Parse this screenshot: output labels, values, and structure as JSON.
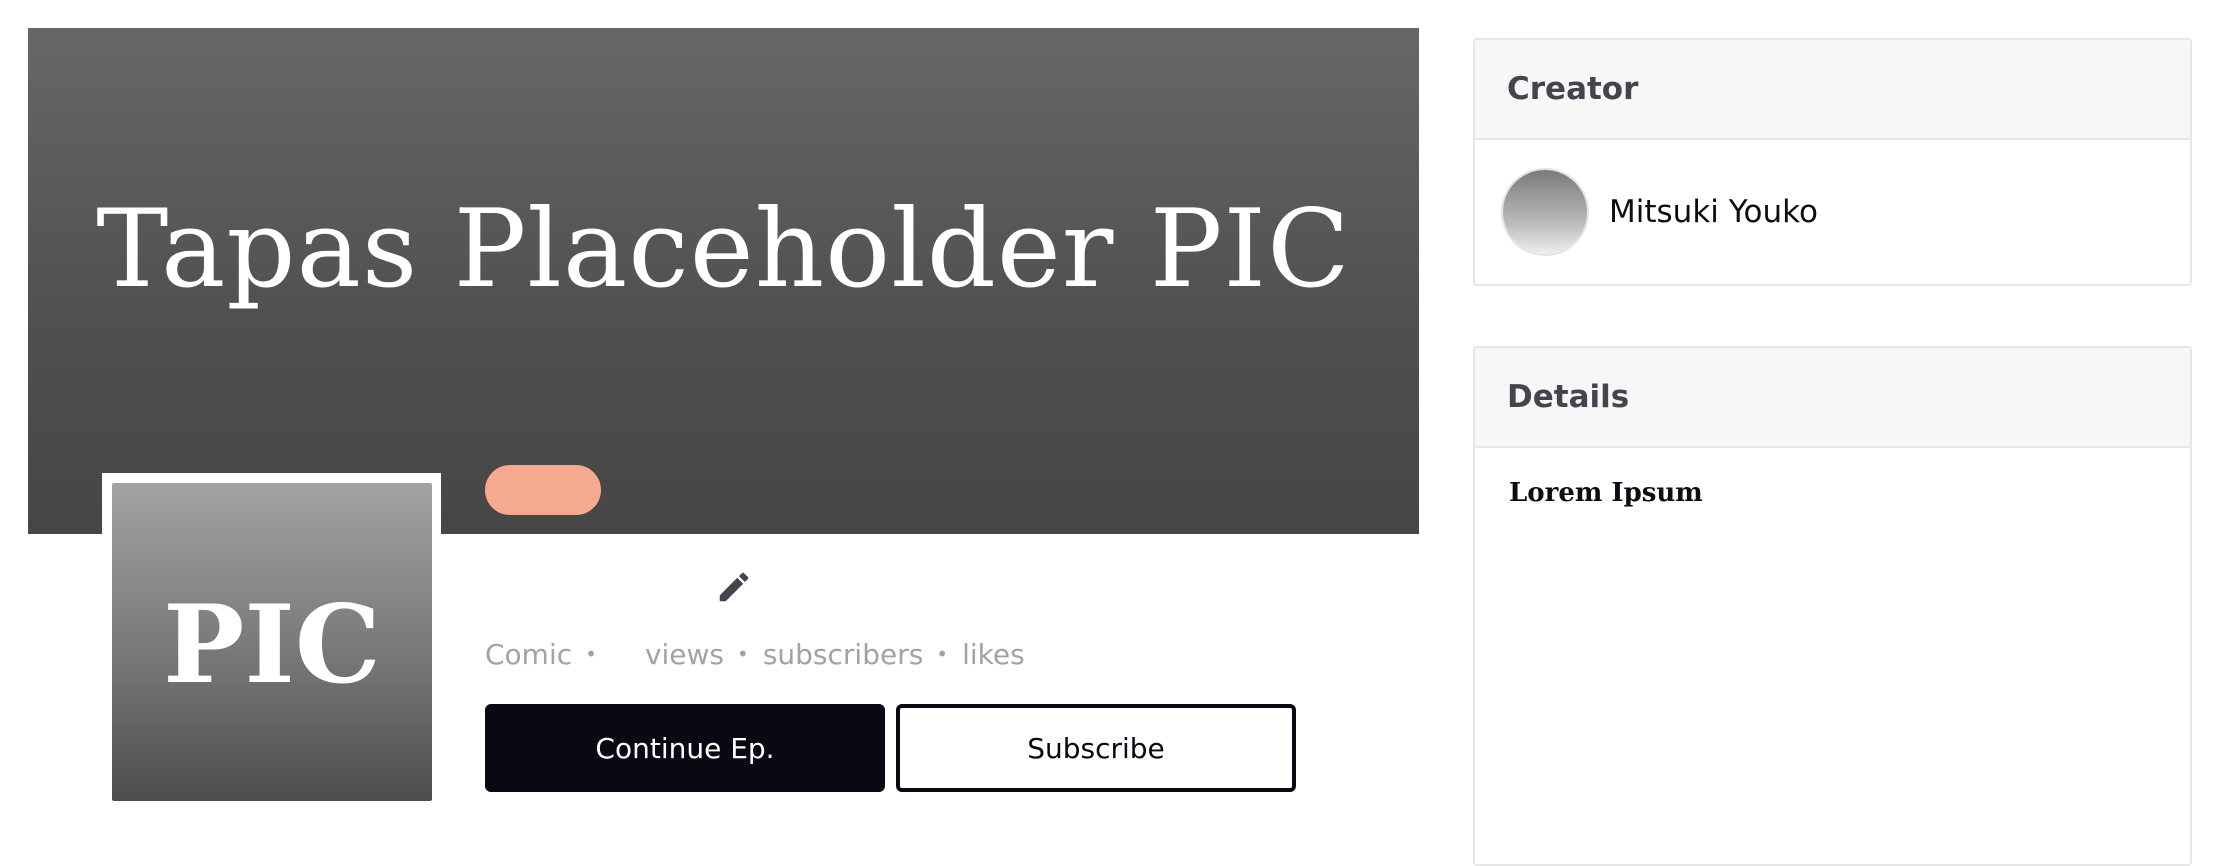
{
  "banner": {
    "title": "Tapas Placeholder PIC"
  },
  "cover": {
    "label": "PIC"
  },
  "genre_pill": {
    "color": "#f5aa8f"
  },
  "edit": {
    "icon": "pencil-icon"
  },
  "stats": {
    "type": "Comic",
    "views_label": "views",
    "subscribers_label": "subscribers",
    "likes_label": "likes",
    "separator": "•"
  },
  "actions": {
    "continue_label": "Continue Ep.",
    "subscribe_label": "Subscribe"
  },
  "creator_panel": {
    "title": "Creator",
    "name": "Mitsuki Youko"
  },
  "details_panel": {
    "title": "Details",
    "description": "Lorem Ipsum"
  },
  "colors": {
    "primary_button": "#090914",
    "accent_pill": "#f5aa8f",
    "muted_text": "#a3a3a3"
  }
}
